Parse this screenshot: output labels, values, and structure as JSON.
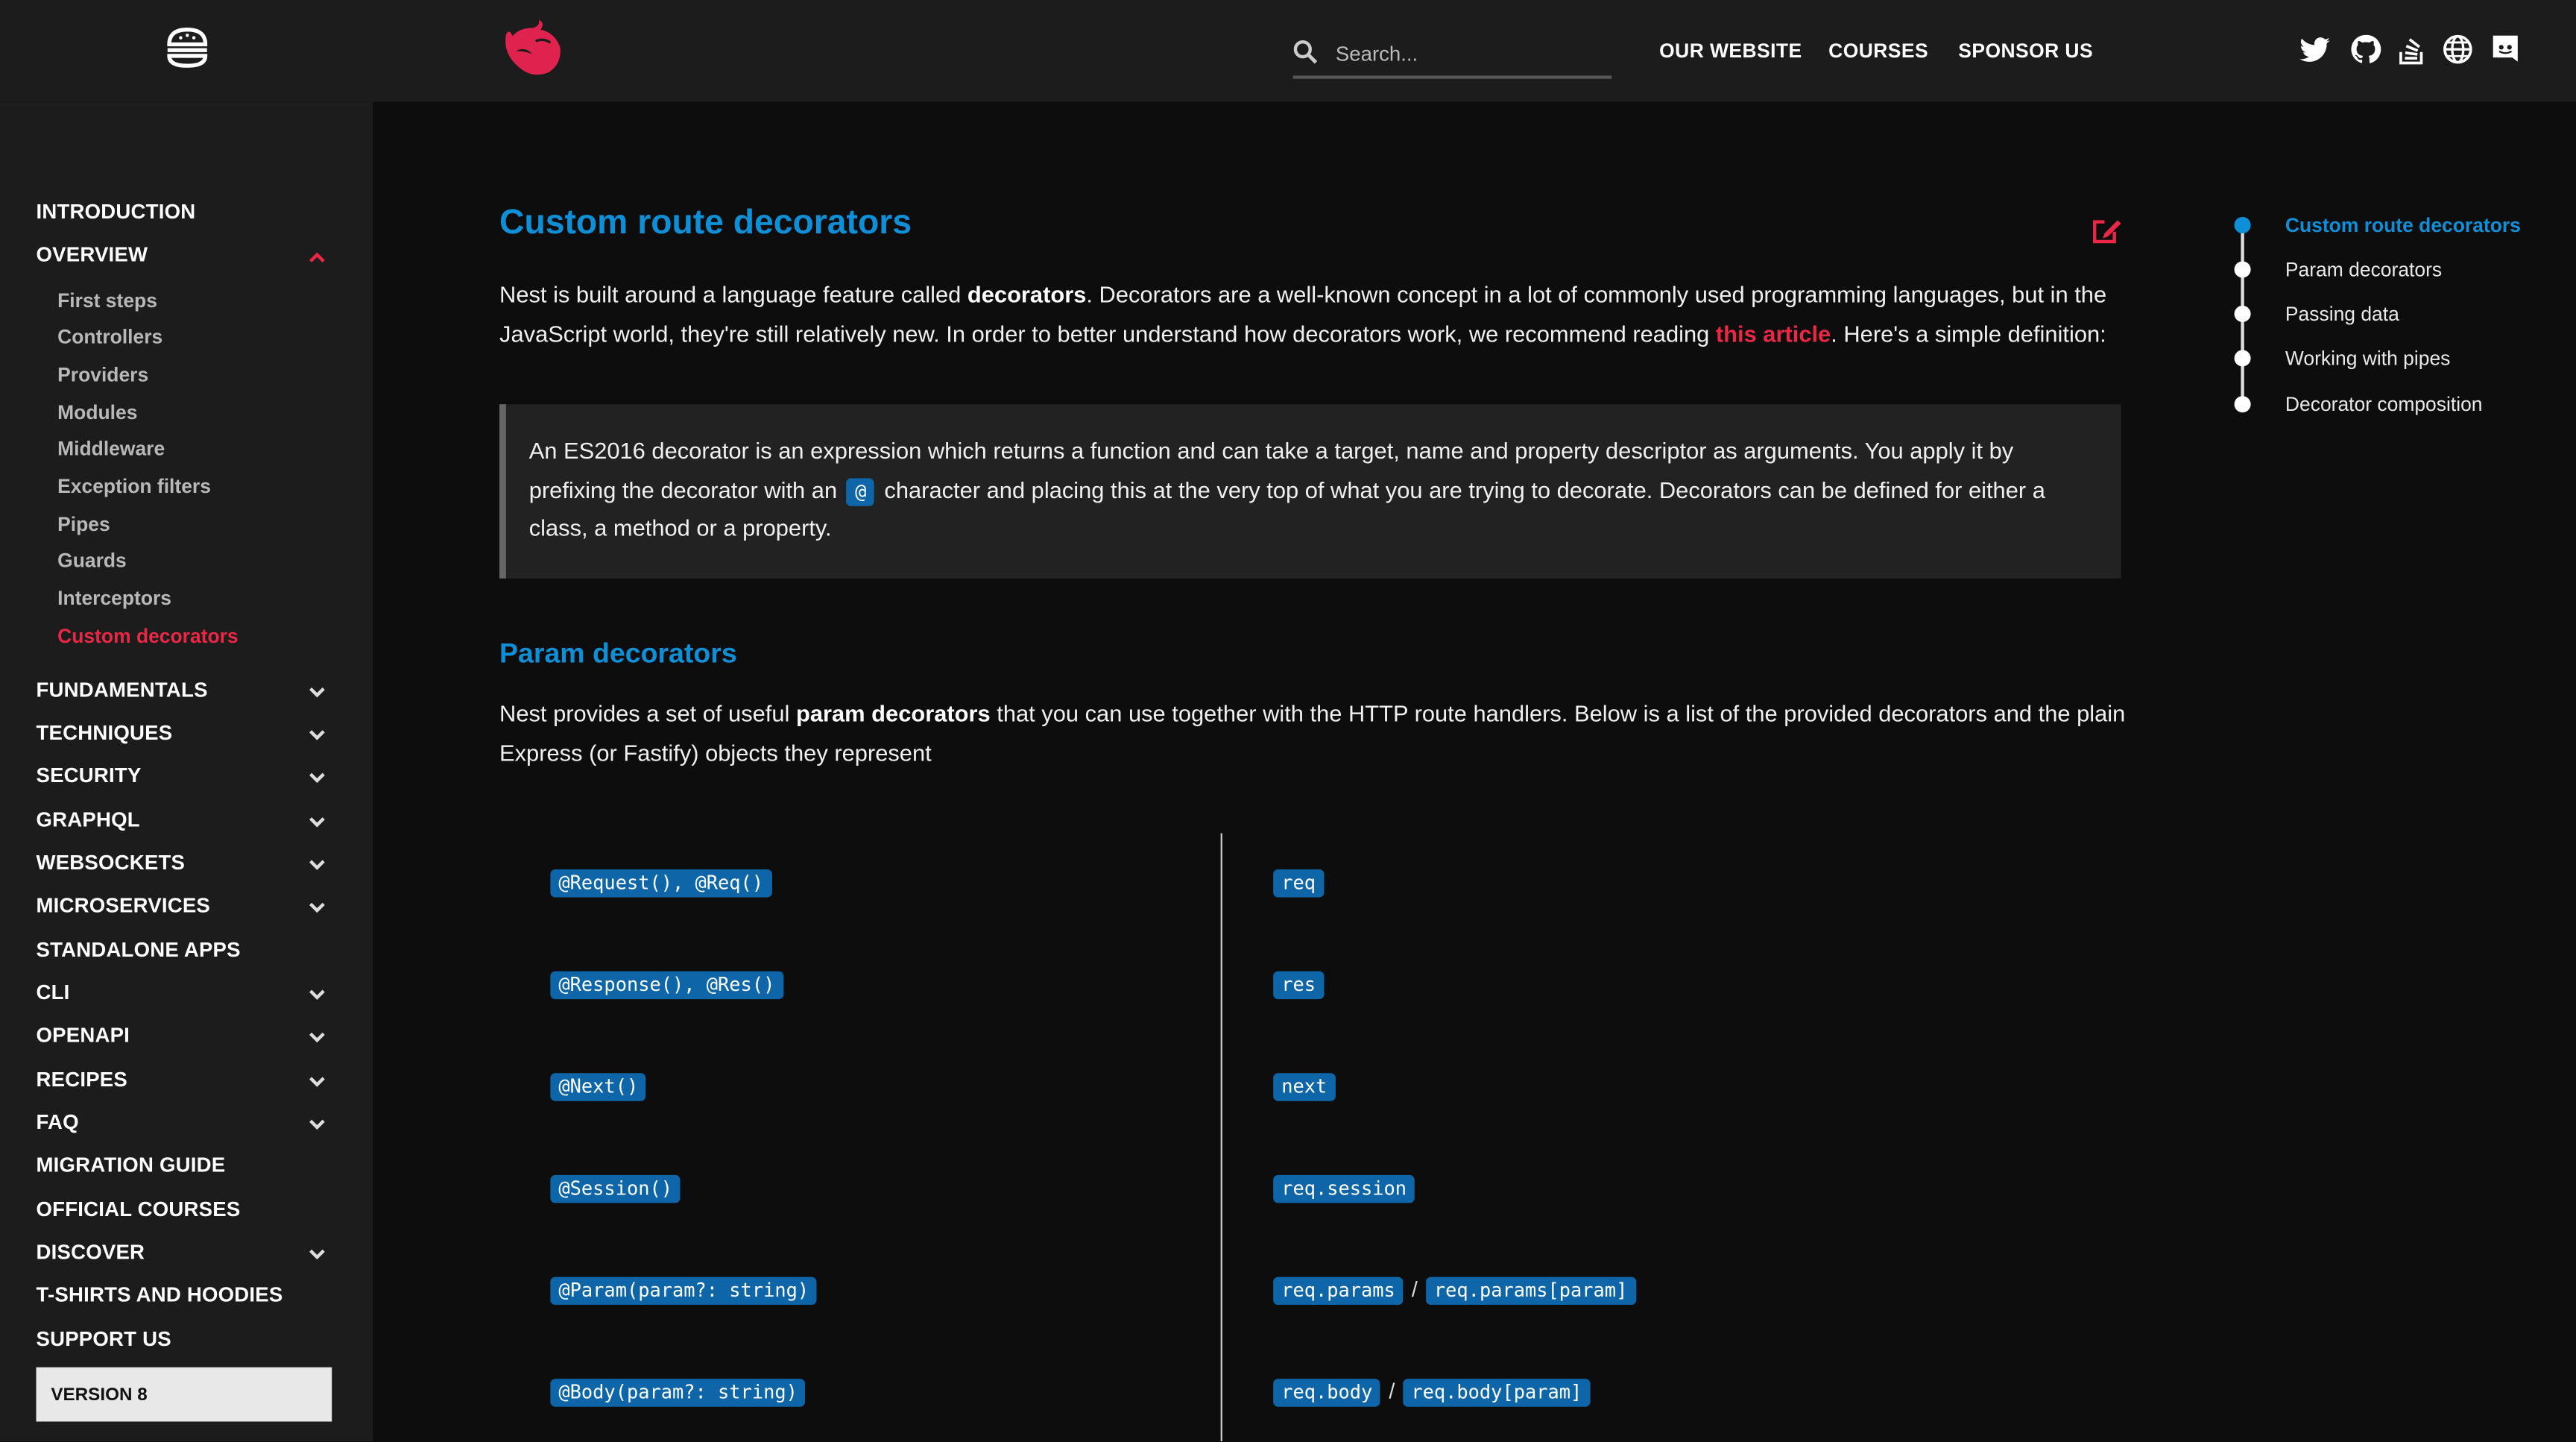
{
  "header": {
    "search_placeholder": "Search...",
    "nav": [
      "OUR WEBSITE",
      "COURSES",
      "SPONSOR US"
    ],
    "social_icons": [
      "twitter-icon",
      "github-icon",
      "stackoverflow-icon",
      "globe-icon",
      "discord-icon"
    ]
  },
  "sidebar": {
    "items": [
      {
        "label": "INTRODUCTION",
        "expandable": false
      },
      {
        "label": "OVERVIEW",
        "expandable": true,
        "expanded": true
      },
      {
        "label": "FUNDAMENTALS",
        "expandable": true
      },
      {
        "label": "TECHNIQUES",
        "expandable": true
      },
      {
        "label": "SECURITY",
        "expandable": true
      },
      {
        "label": "GRAPHQL",
        "expandable": true
      },
      {
        "label": "WEBSOCKETS",
        "expandable": true
      },
      {
        "label": "MICROSERVICES",
        "expandable": true
      },
      {
        "label": "STANDALONE APPS",
        "expandable": false
      },
      {
        "label": "CLI",
        "expandable": true
      },
      {
        "label": "OPENAPI",
        "expandable": true
      },
      {
        "label": "RECIPES",
        "expandable": true
      },
      {
        "label": "FAQ",
        "expandable": true
      },
      {
        "label": "MIGRATION GUIDE",
        "expandable": false
      },
      {
        "label": "OFFICIAL COURSES",
        "expandable": false
      },
      {
        "label": "DISCOVER",
        "expandable": true
      },
      {
        "label": "T-SHIRTS AND HOODIES",
        "expandable": false
      },
      {
        "label": "SUPPORT US",
        "expandable": false
      }
    ],
    "overview_children": [
      "First steps",
      "Controllers",
      "Providers",
      "Modules",
      "Middleware",
      "Exception filters",
      "Pipes",
      "Guards",
      "Interceptors",
      "Custom decorators"
    ],
    "active_child": "Custom decorators",
    "version_label": "VERSION 8"
  },
  "content": {
    "title": "Custom route decorators",
    "intro": {
      "t1": "Nest is built around a language feature called ",
      "b1": "decorators",
      "t2": ". Decorators are a well-known concept in a lot of commonly used programming languages, but in the JavaScript world, they're still relatively new. In order to better understand how decorators work, we recommend reading ",
      "link": "this article",
      "t3": ". Here's a simple definition:"
    },
    "quote": {
      "t1": "An ES2016 decorator is an expression which returns a function and can take a target, name and property descriptor as arguments. You apply it by prefixing the decorator with an ",
      "code": "@",
      "t2": " character and placing this at the very top of what you are trying to decorate. Decorators can be defined for either a class, a method or a property."
    },
    "section_title": "Param decorators",
    "section_intro": {
      "t1": "Nest provides a set of useful ",
      "b1": "param decorators",
      "t2": " that you can use together with the HTTP route handlers. Below is a list of the provided decorators and the plain Express (or Fastify) objects they represent"
    },
    "table_rows": [
      {
        "decorator": "@Request(), @Req()",
        "objects": [
          "req"
        ]
      },
      {
        "decorator": "@Response(), @Res()",
        "objects": [
          "res"
        ]
      },
      {
        "decorator": "@Next()",
        "objects": [
          "next"
        ]
      },
      {
        "decorator": "@Session()",
        "objects": [
          "req.session"
        ]
      },
      {
        "decorator": "@Param(param?: string)",
        "objects": [
          "req.params",
          "req.params[param]"
        ]
      },
      {
        "decorator": "@Body(param?: string)",
        "objects": [
          "req.body",
          "req.body[param]"
        ]
      }
    ],
    "row_separator": "/"
  },
  "toc": {
    "items": [
      "Custom route decorators",
      "Param decorators",
      "Passing data",
      "Working with pipes",
      "Decorator composition"
    ],
    "active": "Custom route decorators"
  },
  "colors": {
    "accent_red": "#ea2845",
    "accent_blue": "#0e90d8",
    "code_chip": "#0e66a8"
  }
}
